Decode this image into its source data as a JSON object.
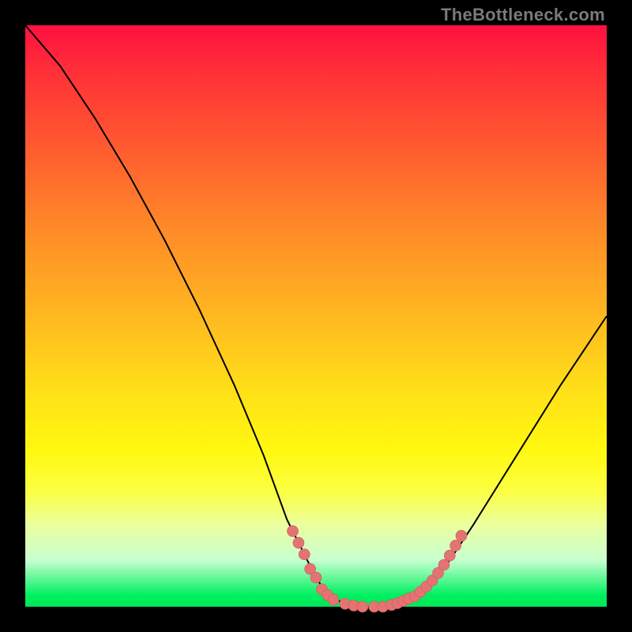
{
  "watermark": "TheBottleneck.com",
  "colors": {
    "curve": "#000000",
    "marker_fill": "#e57373",
    "marker_stroke": "#c75a5a"
  },
  "chart_data": {
    "type": "line",
    "title": "",
    "xlabel": "",
    "ylabel": "",
    "xlim": [
      0,
      100
    ],
    "ylim": [
      0,
      100
    ],
    "grid": false,
    "legend": false,
    "curve": [
      {
        "x": 0,
        "y": 100
      },
      {
        "x": 6,
        "y": 93
      },
      {
        "x": 12,
        "y": 84
      },
      {
        "x": 18,
        "y": 74
      },
      {
        "x": 24,
        "y": 63
      },
      {
        "x": 30,
        "y": 51
      },
      {
        "x": 36,
        "y": 38
      },
      {
        "x": 41,
        "y": 26
      },
      {
        "x": 45,
        "y": 15
      },
      {
        "x": 48,
        "y": 9
      },
      {
        "x": 50,
        "y": 5
      },
      {
        "x": 52,
        "y": 2
      },
      {
        "x": 55,
        "y": 0.5
      },
      {
        "x": 58,
        "y": 0
      },
      {
        "x": 61,
        "y": 0
      },
      {
        "x": 64,
        "y": 0.5
      },
      {
        "x": 67,
        "y": 1.5
      },
      {
        "x": 70,
        "y": 4
      },
      {
        "x": 73,
        "y": 8
      },
      {
        "x": 77,
        "y": 14
      },
      {
        "x": 82,
        "y": 22
      },
      {
        "x": 87,
        "y": 30
      },
      {
        "x": 92,
        "y": 38
      },
      {
        "x": 96,
        "y": 44
      },
      {
        "x": 100,
        "y": 50
      }
    ],
    "markers": [
      {
        "x": 46,
        "y": 13
      },
      {
        "x": 47,
        "y": 11
      },
      {
        "x": 48,
        "y": 9
      },
      {
        "x": 49,
        "y": 6.5
      },
      {
        "x": 50,
        "y": 5
      },
      {
        "x": 51,
        "y": 3
      },
      {
        "x": 52,
        "y": 2
      },
      {
        "x": 53,
        "y": 1.2
      },
      {
        "x": 55,
        "y": 0.5
      },
      {
        "x": 56.5,
        "y": 0.2
      },
      {
        "x": 58,
        "y": 0
      },
      {
        "x": 60,
        "y": 0
      },
      {
        "x": 61.5,
        "y": 0
      },
      {
        "x": 63,
        "y": 0.3
      },
      {
        "x": 64,
        "y": 0.6
      },
      {
        "x": 65,
        "y": 1.0
      },
      {
        "x": 66,
        "y": 1.4
      },
      {
        "x": 67,
        "y": 1.8
      },
      {
        "x": 68,
        "y": 2.6
      },
      {
        "x": 69,
        "y": 3.5
      },
      {
        "x": 70,
        "y": 4.5
      },
      {
        "x": 71,
        "y": 5.8
      },
      {
        "x": 72,
        "y": 7.2
      },
      {
        "x": 73,
        "y": 8.8
      },
      {
        "x": 74,
        "y": 10.5
      },
      {
        "x": 75,
        "y": 12.2
      }
    ]
  }
}
